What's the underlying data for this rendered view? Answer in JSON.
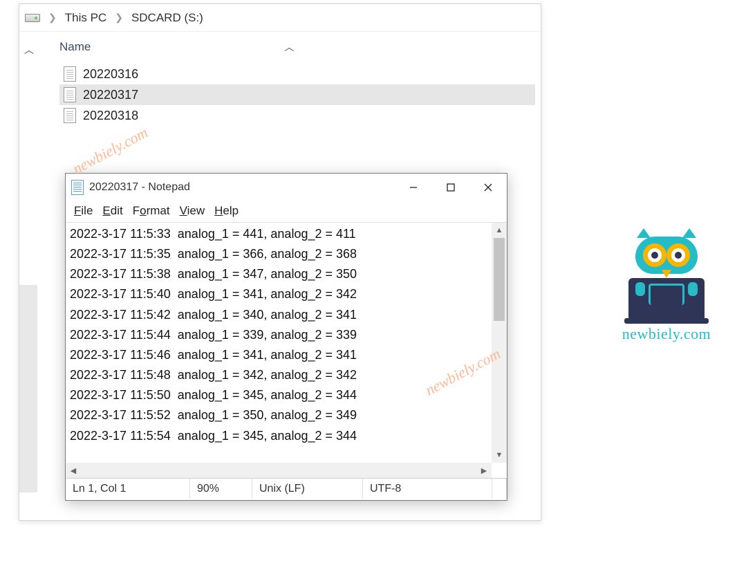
{
  "breadcrumb": {
    "pc": "This PC",
    "drive": "SDCARD (S:)"
  },
  "explorer": {
    "column_header": "Name",
    "files": [
      "20220316",
      "20220317",
      "20220318"
    ],
    "selected_index": 1
  },
  "notepad": {
    "title": "20220317 - Notepad",
    "menu": {
      "file": "File",
      "edit": "Edit",
      "format": "Format",
      "view": "View",
      "help": "Help"
    },
    "lines": [
      "2022-3-17 11:5:33  analog_1 = 441, analog_2 = 411",
      "2022-3-17 11:5:35  analog_1 = 366, analog_2 = 368",
      "2022-3-17 11:5:38  analog_1 = 347, analog_2 = 350",
      "2022-3-17 11:5:40  analog_1 = 341, analog_2 = 342",
      "2022-3-17 11:5:42  analog_1 = 340, analog_2 = 341",
      "2022-3-17 11:5:44  analog_1 = 339, analog_2 = 339",
      "2022-3-17 11:5:46  analog_1 = 341, analog_2 = 341",
      "2022-3-17 11:5:48  analog_1 = 342, analog_2 = 342",
      "2022-3-17 11:5:50  analog_1 = 345, analog_2 = 344",
      "2022-3-17 11:5:52  analog_1 = 350, analog_2 = 349",
      "2022-3-17 11:5:54  analog_1 = 345, analog_2 = 344"
    ],
    "status": {
      "position": "Ln 1, Col 1",
      "zoom": "90%",
      "eol": "Unix (LF)",
      "encoding": "UTF-8"
    }
  },
  "logo": {
    "text": "newbiely.com"
  },
  "watermark": "newbiely.com"
}
